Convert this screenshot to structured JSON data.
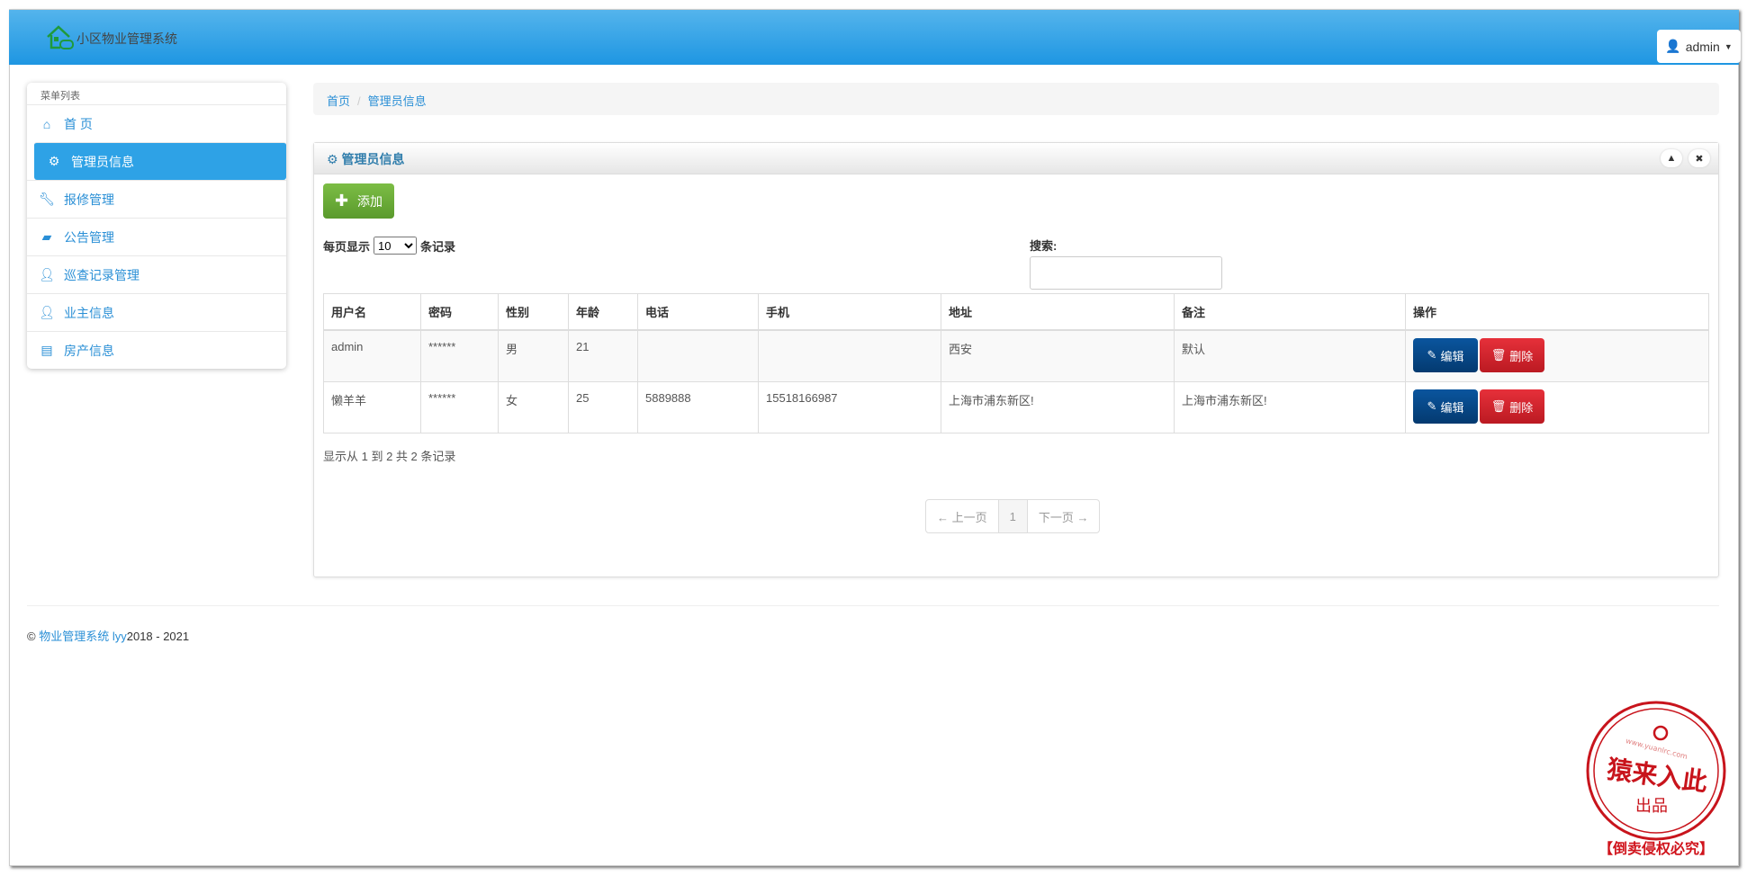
{
  "app": {
    "title": "小区物业管理系统",
    "user": "admin"
  },
  "sidebar": {
    "heading": "菜单列表",
    "items": [
      {
        "label": "首 页",
        "icon": "home-icon"
      },
      {
        "label": "管理员信息",
        "icon": "gear-icon",
        "active": true
      },
      {
        "label": "报修管理",
        "icon": "wrench-icon"
      },
      {
        "label": "公告管理",
        "icon": "briefcase-icon"
      },
      {
        "label": "巡查记录管理",
        "icon": "user-icon"
      },
      {
        "label": "业主信息",
        "icon": "user-icon"
      },
      {
        "label": "房产信息",
        "icon": "list-icon"
      }
    ]
  },
  "breadcrumb": [
    "首页",
    "管理员信息"
  ],
  "panel": {
    "title": "管理员信息",
    "add_label": "添加",
    "per_page_prefix": "每页显示",
    "per_page_value": "10",
    "per_page_suffix": "条记录",
    "search_label": "搜索:",
    "search_value": ""
  },
  "table": {
    "headers": [
      "用户名",
      "密码",
      "性别",
      "年龄",
      "电话",
      "手机",
      "地址",
      "备注",
      "操作"
    ],
    "rows": [
      [
        "admin",
        "******",
        "男",
        "21",
        "",
        "",
        "西安",
        "默认"
      ],
      [
        "懒羊羊",
        "******",
        "女",
        "25",
        "5889888",
        "15518166987",
        "上海市浦东新区!",
        "上海市浦东新区!"
      ]
    ],
    "edit_label": "编辑",
    "delete_label": "删除"
  },
  "info": "显示从 1 到 2 共 2 条记录",
  "pager": {
    "prev": "← 上一页",
    "current": "1",
    "next": "下一页 →"
  },
  "footer": {
    "copy": "©",
    "link": "物业管理系统 lyy",
    "years": "2018 - 2021"
  },
  "stamp": {
    "text": "猿来入此",
    "sub": "出品",
    "url": "www.yuanlrc.com",
    "notice": "【倒卖侵权必究】"
  },
  "colors": {
    "header": "#2ea2e6",
    "edit": "#0a559e",
    "delete": "#d9262f",
    "add": "#6aac36"
  }
}
